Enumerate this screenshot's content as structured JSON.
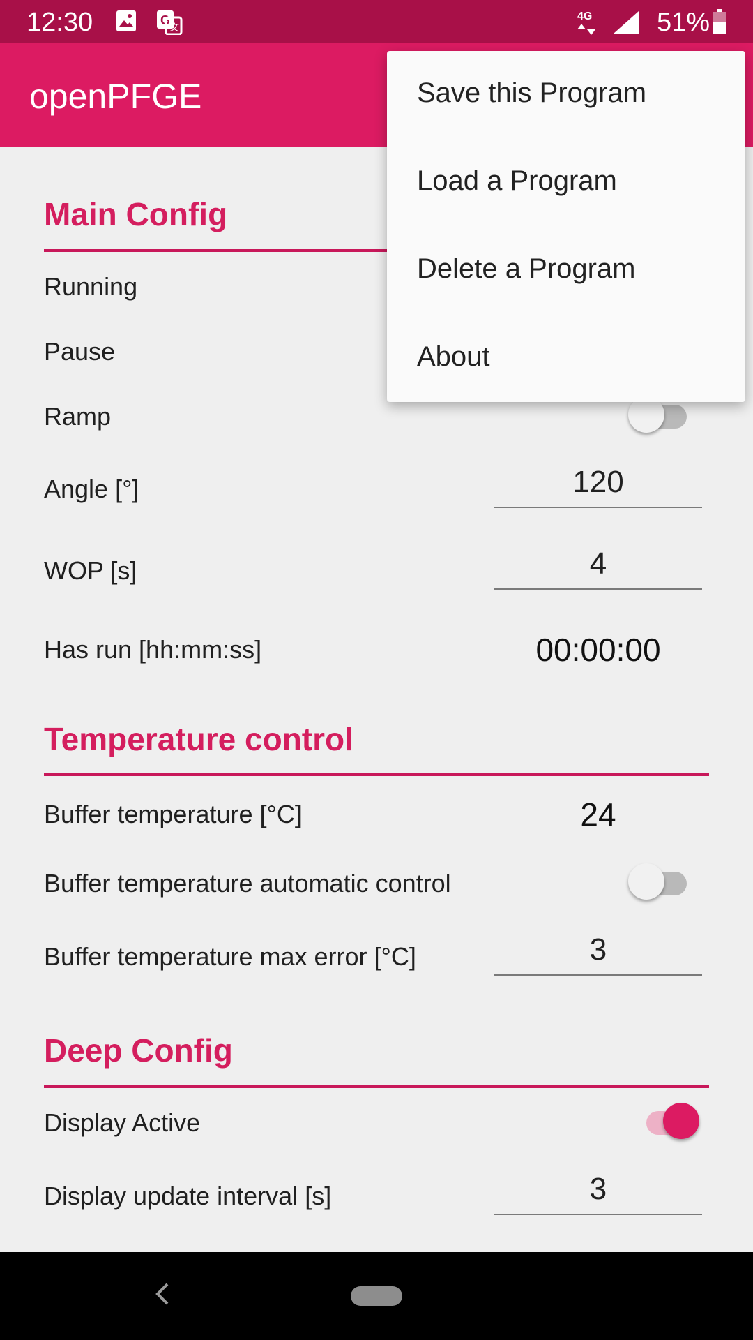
{
  "status_bar": {
    "time": "12:30",
    "network": "4G",
    "battery": "51%",
    "icons": [
      "image-icon",
      "translate-icon",
      "network-4g-icon",
      "signal-icon",
      "battery-icon"
    ]
  },
  "app_bar": {
    "title": "openPFGE",
    "color": "#dc1b62"
  },
  "sections": {
    "main": {
      "title": "Main Config",
      "running_label": "Running",
      "pause_label": "Pause",
      "ramp_label": "Ramp",
      "ramp_on": false,
      "angle_label": "Angle [°]",
      "angle_value": "120",
      "wop_label": "WOP [s]",
      "wop_value": "4",
      "has_run_label": "Has run [hh:mm:ss]",
      "has_run_value": "00:00:00"
    },
    "temperature": {
      "title": "Temperature control",
      "buffer_temp_label": "Buffer temperature [°C]",
      "buffer_temp_value": "24",
      "auto_control_label": "Buffer temperature automatic control",
      "auto_control_on": false,
      "max_error_label": "Buffer temperature max error [°C]",
      "max_error_value": "3"
    },
    "deep": {
      "title": "Deep Config",
      "display_active_label": "Display Active",
      "display_active_on": true,
      "update_interval_label": "Display update interval [s]",
      "update_interval_value": "3"
    }
  },
  "overflow_menu": {
    "items": [
      {
        "label": "Save this Program"
      },
      {
        "label": "Load a Program"
      },
      {
        "label": "Delete a Program"
      },
      {
        "label": "About"
      }
    ]
  },
  "accent_color": "#dc1b62",
  "status_bar_color": "#a81048"
}
